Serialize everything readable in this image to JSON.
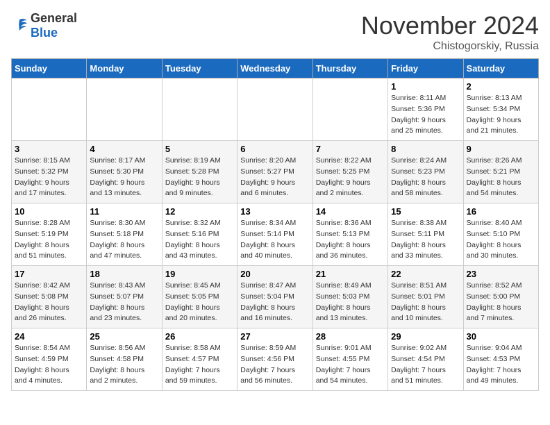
{
  "logo": {
    "general": "General",
    "blue": "Blue"
  },
  "title": "November 2024",
  "location": "Chistogorskiy, Russia",
  "headers": [
    "Sunday",
    "Monday",
    "Tuesday",
    "Wednesday",
    "Thursday",
    "Friday",
    "Saturday"
  ],
  "weeks": [
    [
      {
        "day": "",
        "info": ""
      },
      {
        "day": "",
        "info": ""
      },
      {
        "day": "",
        "info": ""
      },
      {
        "day": "",
        "info": ""
      },
      {
        "day": "",
        "info": ""
      },
      {
        "day": "1",
        "info": "Sunrise: 8:11 AM\nSunset: 5:36 PM\nDaylight: 9 hours\nand 25 minutes."
      },
      {
        "day": "2",
        "info": "Sunrise: 8:13 AM\nSunset: 5:34 PM\nDaylight: 9 hours\nand 21 minutes."
      }
    ],
    [
      {
        "day": "3",
        "info": "Sunrise: 8:15 AM\nSunset: 5:32 PM\nDaylight: 9 hours\nand 17 minutes."
      },
      {
        "day": "4",
        "info": "Sunrise: 8:17 AM\nSunset: 5:30 PM\nDaylight: 9 hours\nand 13 minutes."
      },
      {
        "day": "5",
        "info": "Sunrise: 8:19 AM\nSunset: 5:28 PM\nDaylight: 9 hours\nand 9 minutes."
      },
      {
        "day": "6",
        "info": "Sunrise: 8:20 AM\nSunset: 5:27 PM\nDaylight: 9 hours\nand 6 minutes."
      },
      {
        "day": "7",
        "info": "Sunrise: 8:22 AM\nSunset: 5:25 PM\nDaylight: 9 hours\nand 2 minutes."
      },
      {
        "day": "8",
        "info": "Sunrise: 8:24 AM\nSunset: 5:23 PM\nDaylight: 8 hours\nand 58 minutes."
      },
      {
        "day": "9",
        "info": "Sunrise: 8:26 AM\nSunset: 5:21 PM\nDaylight: 8 hours\nand 54 minutes."
      }
    ],
    [
      {
        "day": "10",
        "info": "Sunrise: 8:28 AM\nSunset: 5:19 PM\nDaylight: 8 hours\nand 51 minutes."
      },
      {
        "day": "11",
        "info": "Sunrise: 8:30 AM\nSunset: 5:18 PM\nDaylight: 8 hours\nand 47 minutes."
      },
      {
        "day": "12",
        "info": "Sunrise: 8:32 AM\nSunset: 5:16 PM\nDaylight: 8 hours\nand 43 minutes."
      },
      {
        "day": "13",
        "info": "Sunrise: 8:34 AM\nSunset: 5:14 PM\nDaylight: 8 hours\nand 40 minutes."
      },
      {
        "day": "14",
        "info": "Sunrise: 8:36 AM\nSunset: 5:13 PM\nDaylight: 8 hours\nand 36 minutes."
      },
      {
        "day": "15",
        "info": "Sunrise: 8:38 AM\nSunset: 5:11 PM\nDaylight: 8 hours\nand 33 minutes."
      },
      {
        "day": "16",
        "info": "Sunrise: 8:40 AM\nSunset: 5:10 PM\nDaylight: 8 hours\nand 30 minutes."
      }
    ],
    [
      {
        "day": "17",
        "info": "Sunrise: 8:42 AM\nSunset: 5:08 PM\nDaylight: 8 hours\nand 26 minutes."
      },
      {
        "day": "18",
        "info": "Sunrise: 8:43 AM\nSunset: 5:07 PM\nDaylight: 8 hours\nand 23 minutes."
      },
      {
        "day": "19",
        "info": "Sunrise: 8:45 AM\nSunset: 5:05 PM\nDaylight: 8 hours\nand 20 minutes."
      },
      {
        "day": "20",
        "info": "Sunrise: 8:47 AM\nSunset: 5:04 PM\nDaylight: 8 hours\nand 16 minutes."
      },
      {
        "day": "21",
        "info": "Sunrise: 8:49 AM\nSunset: 5:03 PM\nDaylight: 8 hours\nand 13 minutes."
      },
      {
        "day": "22",
        "info": "Sunrise: 8:51 AM\nSunset: 5:01 PM\nDaylight: 8 hours\nand 10 minutes."
      },
      {
        "day": "23",
        "info": "Sunrise: 8:52 AM\nSunset: 5:00 PM\nDaylight: 8 hours\nand 7 minutes."
      }
    ],
    [
      {
        "day": "24",
        "info": "Sunrise: 8:54 AM\nSunset: 4:59 PM\nDaylight: 8 hours\nand 4 minutes."
      },
      {
        "day": "25",
        "info": "Sunrise: 8:56 AM\nSunset: 4:58 PM\nDaylight: 8 hours\nand 2 minutes."
      },
      {
        "day": "26",
        "info": "Sunrise: 8:58 AM\nSunset: 4:57 PM\nDaylight: 7 hours\nand 59 minutes."
      },
      {
        "day": "27",
        "info": "Sunrise: 8:59 AM\nSunset: 4:56 PM\nDaylight: 7 hours\nand 56 minutes."
      },
      {
        "day": "28",
        "info": "Sunrise: 9:01 AM\nSunset: 4:55 PM\nDaylight: 7 hours\nand 54 minutes."
      },
      {
        "day": "29",
        "info": "Sunrise: 9:02 AM\nSunset: 4:54 PM\nDaylight: 7 hours\nand 51 minutes."
      },
      {
        "day": "30",
        "info": "Sunrise: 9:04 AM\nSunset: 4:53 PM\nDaylight: 7 hours\nand 49 minutes."
      }
    ]
  ]
}
